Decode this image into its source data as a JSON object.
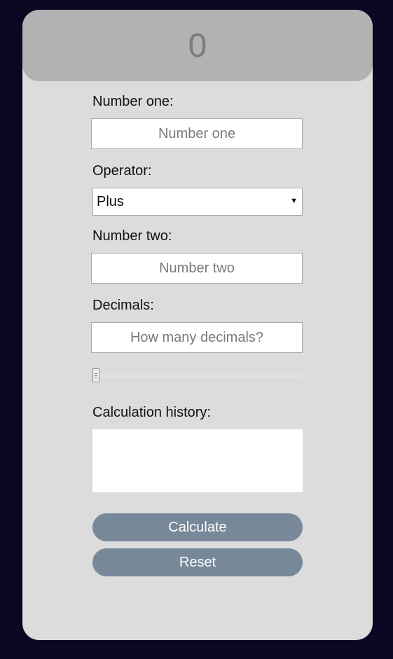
{
  "display": {
    "result": "0"
  },
  "form": {
    "number_one_label": "Number one:",
    "number_one_placeholder": "Number one",
    "number_one_value": "",
    "operator_label": "Operator:",
    "operator_value": "Plus",
    "number_two_label": "Number two:",
    "number_two_placeholder": "Number two",
    "number_two_value": "",
    "decimals_label": "Decimals:",
    "decimals_placeholder": "How many decimals?",
    "decimals_value": "",
    "decimals_slider_level": 0
  },
  "history": {
    "label": "Calculation history:",
    "content": ""
  },
  "buttons": {
    "calculate": "Calculate",
    "reset": "Reset"
  },
  "colors": {
    "page_background": "#0d0623",
    "card": "#dcdcdc",
    "display": "#b3b1b3",
    "button": "#778899"
  },
  "icons": {
    "select_arrow": "dropdown-arrow-icon",
    "slider_grip": "slider-grip-icon"
  }
}
